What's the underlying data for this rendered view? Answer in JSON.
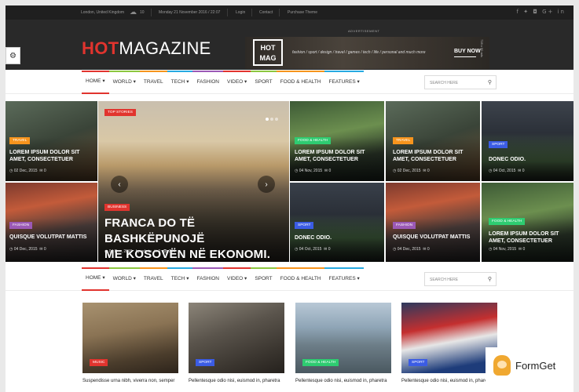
{
  "topbar": {
    "location": "London, United Kingdom",
    "temperature": "10",
    "date": "Monday 21 November 2016 / 22:07",
    "login": "Login",
    "contact": "Contact",
    "purchase": "Purchase Theme",
    "social_icons": [
      "facebook-icon",
      "twitter-icon",
      "instagram-icon",
      "google-plus-icon",
      "linkedin-icon"
    ],
    "social_glyphs": "f ✦ ◘ G+ in"
  },
  "header": {
    "logo_hot": "HOT",
    "logo_magazine": "MAGAZINE",
    "advertisement_label": "ADVERTISEMENT",
    "banner": {
      "logo_line1": "HOT",
      "logo_line2": "MAG",
      "tagline": "fashion / sport / design / travel / games / tech / life / personal and much more",
      "cta": "BUY NOW",
      "size": "728 x 90 ads"
    }
  },
  "nav": {
    "items": [
      {
        "label": "HOME",
        "chevron": "▾",
        "color": "#e1342e"
      },
      {
        "label": "WORLD",
        "chevron": "▾",
        "color": "#8cc63f"
      },
      {
        "label": "TRAVEL",
        "chevron": "",
        "color": "#f7941d"
      },
      {
        "label": "TECH",
        "chevron": "▾",
        "color": "#27aae1"
      },
      {
        "label": "FASHION",
        "chevron": "",
        "color": "#9b59b6"
      },
      {
        "label": "VIDEO",
        "chevron": "▾",
        "color": "#e1342e"
      },
      {
        "label": "SPORT",
        "chevron": "",
        "color": "#8cc63f"
      },
      {
        "label": "FOOD & HEALTH",
        "chevron": "",
        "color": "#f7941d"
      },
      {
        "label": "FEATURES",
        "chevron": "▾",
        "color": "#27aae1"
      }
    ],
    "search_placeholder": "SEARCH HERE"
  },
  "featured": {
    "top_stories": "TOP STORIES",
    "category": "BUSINESS",
    "title_line1": "FRANCA DO TË BASHKËPUNOJË",
    "title_line2": "ME KOSOVËN NË EKONOMI.",
    "date": "04 Dec, 2015",
    "author": "by admin",
    "comments": "0",
    "views": "734"
  },
  "tiles": [
    {
      "category": "TRAVEL",
      "cat_color": "#f7941d",
      "title_line1": "LOREM IPSUM DOLOR SIT",
      "title_line2": "AMET, CONSECTETUER",
      "date": "02 Dec, 2015",
      "comments": "0"
    },
    {
      "category": "FASHION",
      "cat_color": "#9b59b6",
      "title_line1": "QUISQUE VOLUTPAT MATTIS",
      "title_line2": "",
      "date": "04 Dec, 2015",
      "comments": "0"
    },
    {
      "category": "FOOD & HEALTH",
      "cat_color": "#2ecc71",
      "title_line1": "LOREM IPSUM DOLOR SIT",
      "title_line2": "AMET, CONSECTETUER",
      "date": "04 Nov, 2015",
      "comments": "0"
    },
    {
      "category": "SPORT",
      "cat_color": "#3b5ce4",
      "title_line1": "DONEC ODIO.",
      "title_line2": "",
      "date": "04 Oct, 2015",
      "comments": "0"
    },
    {
      "category": "TRAVEL",
      "cat_color": "#f7941d",
      "title_line1": "LOREM IPSUM DOLOR SIT",
      "title_line2": "AMET, CONSECTETUER",
      "date": "02 Dec, 2015",
      "comments": "0"
    },
    {
      "category": "FASHION",
      "cat_color": "#9b59b6",
      "title_line1": "QUISQUE VOLUTPAT MATTIS",
      "title_line2": "",
      "date": "04 Dec, 2015",
      "comments": "0"
    },
    {
      "category": "SPORT",
      "cat_color": "#3b5ce4",
      "title_line1": "DONEC ODIO.",
      "title_line2": "",
      "date": "04 Oct, 2015",
      "comments": "0"
    },
    {
      "category": "FOOD & HEALTH",
      "cat_color": "#2ecc71",
      "title_line1": "LOREM IPSUM DOLOR SIT",
      "title_line2": "AMET, CONSECTETUER",
      "date": "04 Nov, 2015",
      "comments": "0"
    }
  ],
  "cards": [
    {
      "category": "MUSIC",
      "cat_color": "#e1342e",
      "caption": "Suspendisse urna nibh, viverra non, semper"
    },
    {
      "category": "SPORT",
      "cat_color": "#3b5ce4",
      "caption": "Pellentesque odio nisi, euismod in, pharetra"
    },
    {
      "category": "FOOD & HEALTH",
      "cat_color": "#2ecc71",
      "caption": "Pellentesque odio nisi, euismod in, pharetra"
    },
    {
      "category": "SPORT",
      "cat_color": "#3b5ce4",
      "caption": "Pellentesque odio nisi, euismod in, pharetra"
    }
  ],
  "watermark": {
    "brand": "FormGet"
  }
}
